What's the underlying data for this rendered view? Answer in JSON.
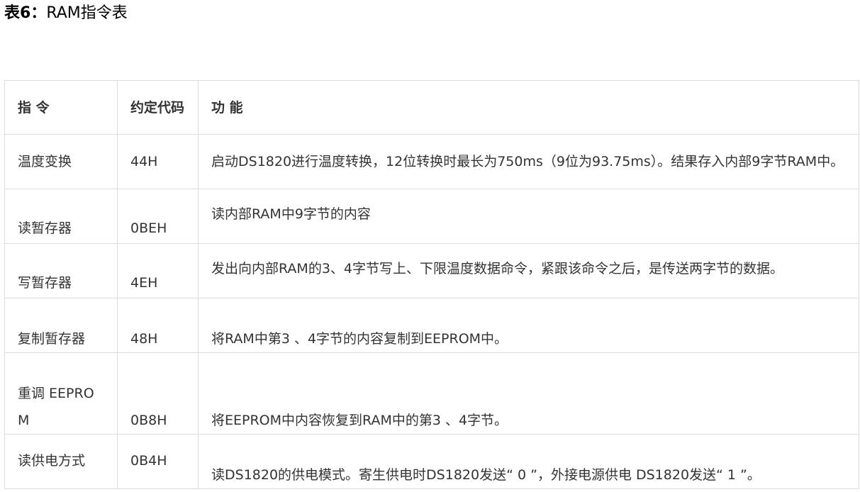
{
  "title": {
    "prefix": "表6：",
    "text": "RAM指令表"
  },
  "table": {
    "headers": [
      "指 令",
      "约定代码",
      "功 能"
    ],
    "rows": [
      {
        "command": "温度变换",
        "code": "44H",
        "function": "启动DS1820进行温度转换，12位转换时最长为750ms（9位为93.75ms）。结果存入内部9字节RAM中。"
      },
      {
        "command": "读暂存器",
        "code": "0BEH",
        "function": "读内部RAM中9字节的内容"
      },
      {
        "command": "写暂存器",
        "code": "4EH",
        "function": "发出向内部RAM的3、4字节写上、下限温度数据命令，紧跟该命令之后，是传送两字节的数据。"
      },
      {
        "command": "复制暂存器",
        "code": "48H",
        "function": "将RAM中第3 、4字节的内容复制到EEPROM中。"
      },
      {
        "command": "重调 EEPROM",
        "code": "0B8H",
        "function": "将EEPROM中内容恢复到RAM中的第3 、4字节。"
      },
      {
        "command": "读供电方式",
        "code": "0B4H",
        "function": "读DS1820的供电模式。寄生供电时DS1820发送“ 0 ”，外接电源供电 DS1820发送“ 1 ”。"
      }
    ]
  }
}
